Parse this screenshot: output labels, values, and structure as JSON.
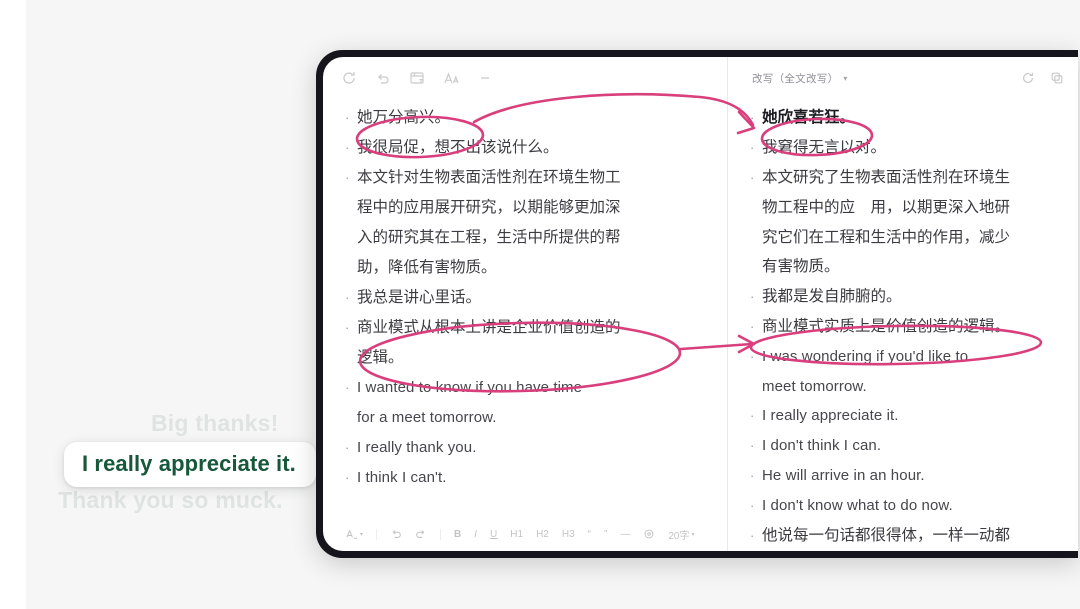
{
  "promo": {
    "ghost_top": "Big thanks!",
    "ghost_bottom": "Thank you so muck.",
    "highlight": "I really appreciate it.",
    "highlight_color": "#17573a",
    "ghost_color": "#dfe3e1"
  },
  "annotation": {
    "ink_color": "#d93f7c",
    "arrow_color": "#17573a"
  },
  "left_pane": {
    "toolbar": [
      {
        "icon": "refresh-icon"
      },
      {
        "icon": "undo-arrow-icon"
      },
      {
        "icon": "translate-icon"
      },
      {
        "icon": "font-size-icon"
      },
      {
        "icon": "minus-icon"
      }
    ],
    "lines": [
      {
        "text": "她万分高兴。",
        "lang": "zh",
        "continuation": false,
        "circled": true
      },
      {
        "text": "我很局促，想不出该说什么。",
        "lang": "zh",
        "continuation": false
      },
      {
        "text": "本文针对生物表面活性剂在环境生物工",
        "lang": "zh",
        "continuation": false
      },
      {
        "text": "程中的应用展开研究，以期能够更加深",
        "lang": "zh",
        "continuation": true
      },
      {
        "text": "入的研究其在工程，生活中所提供的帮",
        "lang": "zh",
        "continuation": true
      },
      {
        "text": "助，降低有害物质。",
        "lang": "zh",
        "continuation": true
      },
      {
        "text": "我总是讲心里话。",
        "lang": "zh",
        "continuation": false
      },
      {
        "text": "商业模式从根本上讲是企业价值创造的",
        "lang": "zh",
        "continuation": false,
        "circled": true
      },
      {
        "text": "逻辑。",
        "lang": "zh",
        "continuation": true
      },
      {
        "text": "I wanted to know if you have time",
        "lang": "en",
        "continuation": false
      },
      {
        "text": "for a meet tomorrow.",
        "lang": "en",
        "continuation": true
      },
      {
        "text": "I really thank you.",
        "lang": "en",
        "continuation": false,
        "arrow_target": true
      },
      {
        "text": "I think I can't.",
        "lang": "en",
        "continuation": false
      }
    ],
    "format_bar": {
      "style_label": "style",
      "undo_label": "undo",
      "redo_label": "redo",
      "bold_label": "B",
      "italic_label": "I",
      "underline_label": "U",
      "h1_label": "H1",
      "h2_label": "H2",
      "h3_label": "H3",
      "quote_open_label": "“",
      "quote_close_label": "”",
      "divider_label": "—",
      "emoji_label": "emoji-icon",
      "word_count": "20字"
    }
  },
  "right_pane": {
    "header": {
      "title": "改写（全文改写）",
      "caret": "▾",
      "actions": [
        {
          "icon": "refresh-icon"
        },
        {
          "icon": "copy-icon"
        }
      ]
    },
    "lines": [
      {
        "text": "她欣喜若狂。",
        "lang": "zh",
        "continuation": false,
        "highlight": true,
        "circled": true
      },
      {
        "text": "我窘得无言以对。",
        "lang": "zh",
        "continuation": false
      },
      {
        "text": "本文研究了生物表面活性剂在环境生",
        "lang": "zh",
        "continuation": false
      },
      {
        "text": "物工程中的应　用，以期更深入地研",
        "lang": "zh",
        "continuation": true
      },
      {
        "text": "究它们在工程和生活中的作用，减少",
        "lang": "zh",
        "continuation": true
      },
      {
        "text": "有害物质。",
        "lang": "zh",
        "continuation": true
      },
      {
        "text": "我都是发自肺腑的。",
        "lang": "zh",
        "continuation": false
      },
      {
        "text": "商业模式实质上是价值创造的逻辑。",
        "lang": "zh",
        "continuation": false,
        "circled": true
      },
      {
        "text": "I was wondering if you'd like to",
        "lang": "en",
        "continuation": false
      },
      {
        "text": "meet tomorrow.",
        "lang": "en",
        "continuation": true
      },
      {
        "text": "I really appreciate it.",
        "lang": "en",
        "continuation": false
      },
      {
        "text": "I don't think I can.",
        "lang": "en",
        "continuation": false
      },
      {
        "text": "He will arrive in an hour.",
        "lang": "en",
        "continuation": false
      },
      {
        "text": "I don't know what to do now.",
        "lang": "en",
        "continuation": false
      },
      {
        "text": "他说每一句话都很得体，一样一动都",
        "lang": "zh",
        "continuation": false,
        "clipped": true
      }
    ]
  }
}
